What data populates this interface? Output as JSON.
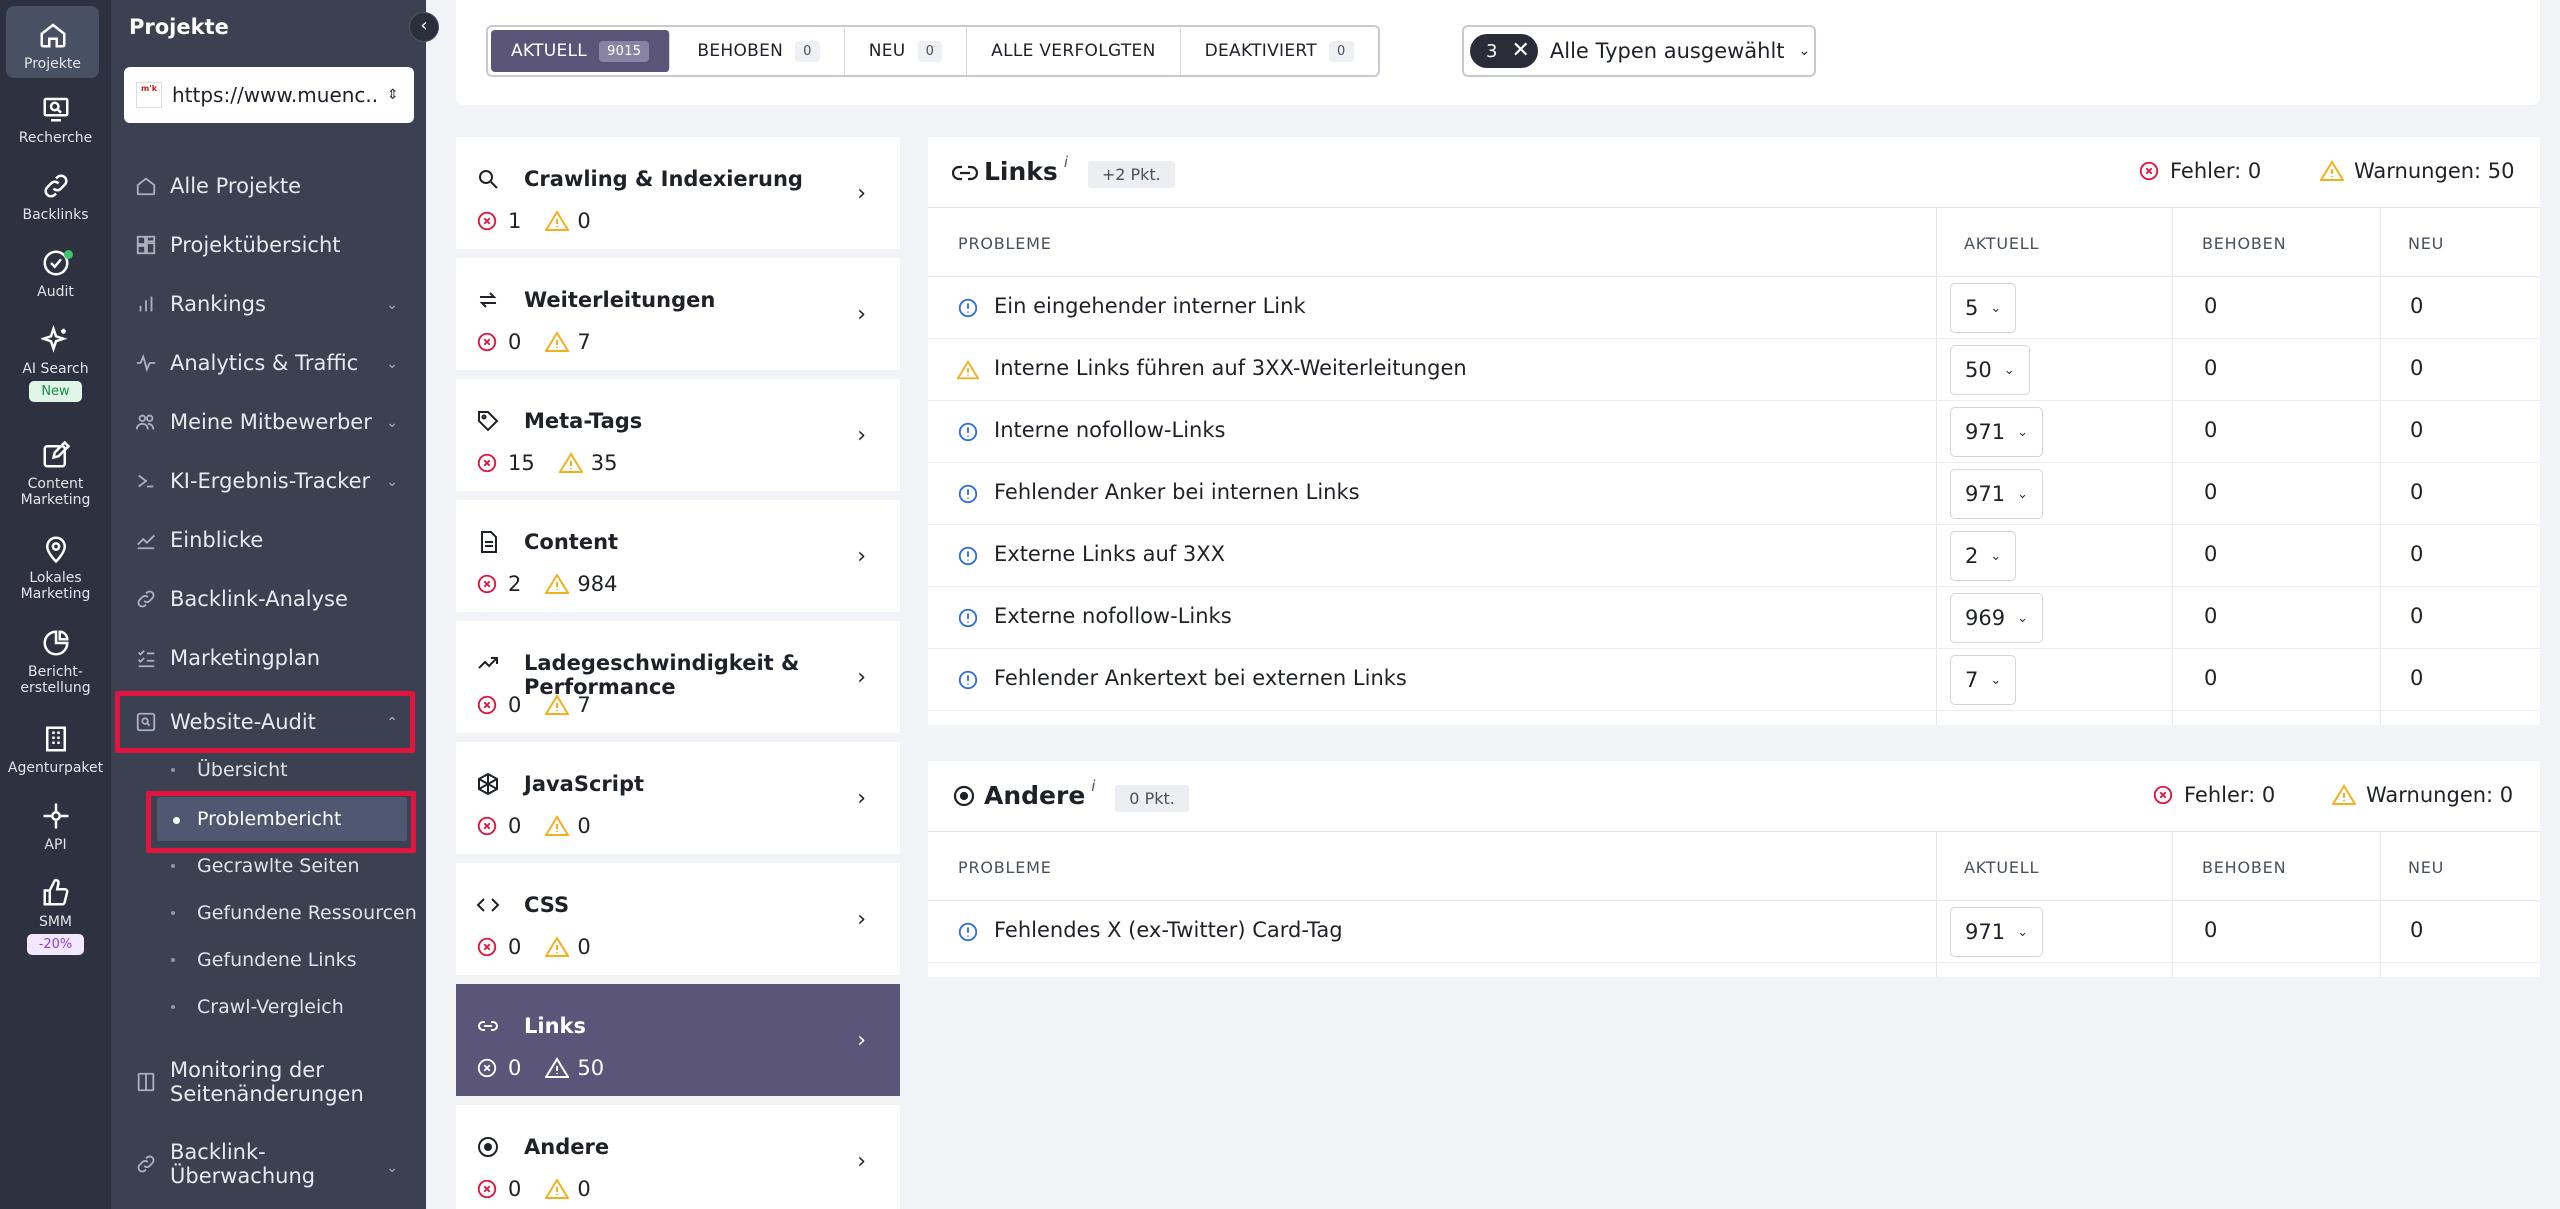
{
  "rail": {
    "items": [
      {
        "label": "Projekte",
        "icon": "home-icon"
      },
      {
        "label": "Recherche",
        "icon": "research-icon"
      },
      {
        "label": "Backlinks",
        "icon": "link-icon"
      },
      {
        "label": "Audit",
        "icon": "audit-icon"
      },
      {
        "label": "AI Search",
        "icon": "sparkle-icon",
        "badge": "New"
      },
      {
        "label": "Content Marketing",
        "icon": "edit-icon"
      },
      {
        "label": "Lokales Marketing",
        "icon": "location-pin-icon"
      },
      {
        "label": "Bericht-erstellung",
        "icon": "pie-chart-icon"
      },
      {
        "label": "Agenturpaket",
        "icon": "building-icon"
      },
      {
        "label": "API",
        "icon": "api-icon"
      },
      {
        "label": "SMM",
        "icon": "thumbs-up-icon",
        "badge": "-20%"
      }
    ]
  },
  "sidebar": {
    "title": "Projekte",
    "project_url": "https://www.muenc...",
    "project_logo_text": "m'k",
    "nav": [
      {
        "label": "Alle Projekte",
        "icon": "home-icon"
      },
      {
        "label": "Projektübersicht",
        "icon": "dashboard-icon"
      },
      {
        "label": "Rankings",
        "icon": "bar-chart-icon"
      },
      {
        "label": "Analytics & Traffic",
        "icon": "pulse-icon"
      },
      {
        "label": "Meine Mitbewerber",
        "icon": "people-icon"
      },
      {
        "label": "KI-Ergebnis-Tracker",
        "icon": "ai-chevron-icon"
      },
      {
        "label": "Einblicke",
        "icon": "trend-icon"
      },
      {
        "label": "Backlink-Analyse",
        "icon": "link-icon"
      },
      {
        "label": "Marketingplan",
        "icon": "checklist-icon"
      },
      {
        "label": "Website-Audit",
        "icon": "audit-search-icon"
      }
    ],
    "audit_sub": [
      "Übersicht",
      "Problembericht",
      "Gecrawlte Seiten",
      "Gefundene Ressourcen",
      "Gefundene Links",
      "Crawl-Vergleich"
    ],
    "nav_bottom": [
      {
        "label": "Monitoring der Seitenänderungen",
        "icon": "monitor-icon"
      },
      {
        "label": "Backlink-Überwachung",
        "icon": "link-icon"
      }
    ]
  },
  "tabs": [
    {
      "label": "AKTUELL",
      "count": "9015"
    },
    {
      "label": "BEHOBEN",
      "count": "0"
    },
    {
      "label": "NEU",
      "count": "0"
    },
    {
      "label": "ALLE VERFOLGTEN",
      "count": ""
    },
    {
      "label": "DEAKTIVIERT",
      "count": "0"
    }
  ],
  "type_filter": {
    "count": "3",
    "label": "Alle Typen ausgewählt"
  },
  "categories": [
    {
      "name": "Crawling & Indexierung",
      "errors": "1",
      "warnings": "0",
      "icon": "search-icon"
    },
    {
      "name": "Weiterleitungen",
      "errors": "0",
      "warnings": "7",
      "icon": "redirect-icon"
    },
    {
      "name": "Meta-Tags",
      "errors": "15",
      "warnings": "35",
      "icon": "tag-icon"
    },
    {
      "name": "Content",
      "errors": "2",
      "warnings": "984",
      "icon": "document-icon"
    },
    {
      "name": "Ladegeschwindigkeit & Performance",
      "errors": "0",
      "warnings": "7",
      "icon": "trend-up-icon"
    },
    {
      "name": "JavaScript",
      "errors": "0",
      "warnings": "0",
      "icon": "js-icon"
    },
    {
      "name": "CSS",
      "errors": "0",
      "warnings": "0",
      "icon": "code-icon"
    },
    {
      "name": "Links",
      "errors": "0",
      "warnings": "50",
      "icon": "link-icon"
    },
    {
      "name": "Andere",
      "errors": "0",
      "warnings": "0",
      "icon": "target-icon"
    }
  ],
  "links_panel": {
    "title": "Links",
    "info": "i",
    "points": "+2 Pkt.",
    "errors_label": "Fehler: 0",
    "warnings_label": "Warnungen: 50",
    "headers": {
      "problems": "PROBLEME",
      "current": "AKTUELL",
      "fixed": "BEHOBEN",
      "new": "NEU"
    },
    "rows": [
      {
        "label": "Ein eingehender interner Link",
        "type": "info",
        "current": "5",
        "fixed": "0",
        "new": "0"
      },
      {
        "label": "Interne Links führen auf 3XX-Weiterleitungen",
        "type": "warning",
        "current": "50",
        "fixed": "0",
        "new": "0"
      },
      {
        "label": "Interne nofollow-Links",
        "type": "info",
        "current": "971",
        "fixed": "0",
        "new": "0"
      },
      {
        "label": "Fehlender Anker bei internen Links",
        "type": "info",
        "current": "971",
        "fixed": "0",
        "new": "0"
      },
      {
        "label": "Externe Links auf 3XX",
        "type": "info",
        "current": "2",
        "fixed": "0",
        "new": "0"
      },
      {
        "label": "Externe nofollow-Links",
        "type": "info",
        "current": "969",
        "fixed": "0",
        "new": "0"
      },
      {
        "label": "Fehlender Ankertext bei externen Links",
        "type": "info",
        "current": "7",
        "fixed": "0",
        "new": "0"
      }
    ]
  },
  "other_panel": {
    "title": "Andere",
    "info": "i",
    "points": "0 Pkt.",
    "errors_label": "Fehler: 0",
    "warnings_label": "Warnungen: 0",
    "headers": {
      "problems": "PROBLEME",
      "current": "AKTUELL",
      "fixed": "BEHOBEN",
      "new": "NEU"
    },
    "rows": [
      {
        "label": "Fehlendes X (ex-Twitter) Card-Tag",
        "type": "info",
        "current": "971",
        "fixed": "0",
        "new": "0"
      }
    ]
  },
  "colors": {
    "accent": "#5b5579",
    "error": "#e0143c",
    "warning": "#f2b01e",
    "info": "#2f6fd6"
  }
}
